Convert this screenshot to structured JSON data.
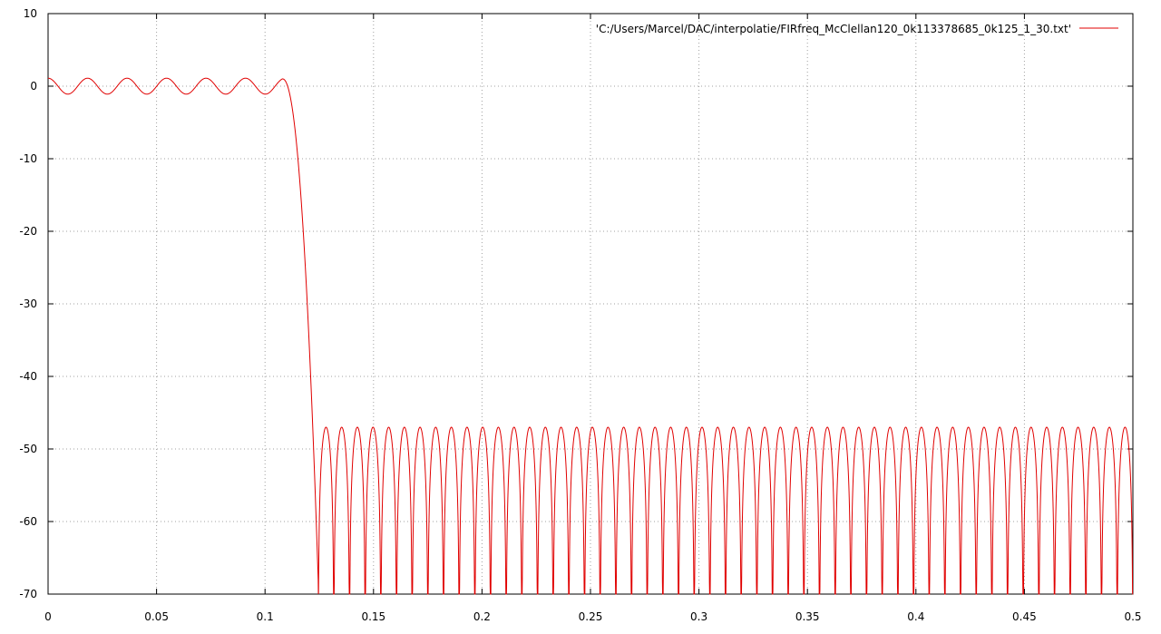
{
  "chart_data": {
    "type": "line",
    "title": "",
    "xlabel": "",
    "ylabel": "",
    "xlim": [
      0,
      0.5
    ],
    "ylim": [
      -70,
      10
    ],
    "x_ticks": [
      "0",
      "0.05",
      "0.1",
      "0.15",
      "0.2",
      "0.25",
      "0.3",
      "0.35",
      "0.4",
      "0.45",
      "0.5"
    ],
    "y_ticks": [
      "10",
      "0",
      "-10",
      "-20",
      "-30",
      "-40",
      "-50",
      "-60",
      "-70"
    ],
    "grid": true,
    "legend_position": "top-right",
    "series": [
      {
        "name": "'C:/Users/Marcel/DAC/interpolatie/FIRfreq_McClellan120_0k113378685_0k125_1_30.txt'",
        "color": "#e00000",
        "description_of_shape": "lowpass FIR magnitude response in dB",
        "passband": {
          "x_end": 0.108,
          "ripple_db": 1.1,
          "ripple_peaks_x": [
            0.0,
            0.0182,
            0.0364,
            0.0546,
            0.0728,
            0.091,
            0.108
          ]
        },
        "transition": {
          "x_start": 0.108,
          "x_end": 0.1245
        },
        "stopband": {
          "x_start": 0.1245,
          "peak_db": -47,
          "min_db": -70,
          "lobe_count": 52
        }
      }
    ]
  }
}
